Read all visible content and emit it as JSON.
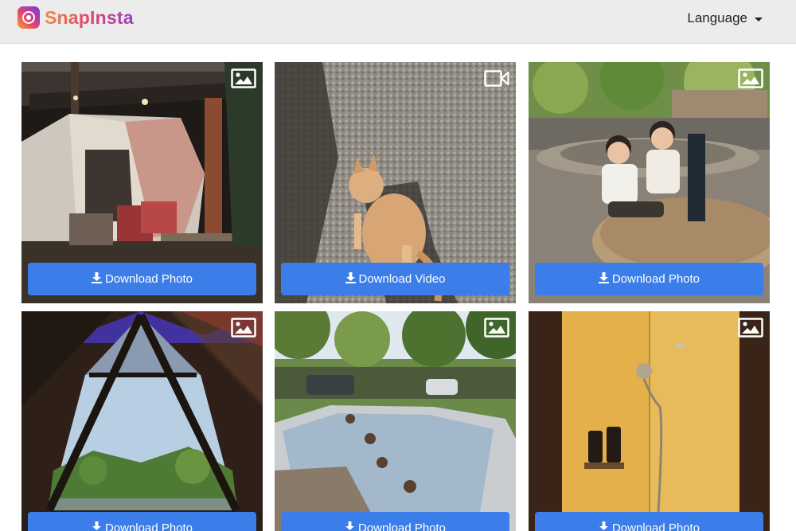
{
  "header": {
    "brand_name": "SnapInsta",
    "language_label": "Language"
  },
  "accent_color": "#3b7de9",
  "cards": [
    {
      "media_type": "image-icon",
      "button_label": "Download Photo"
    },
    {
      "media_type": "video-icon",
      "button_label": "Download Video"
    },
    {
      "media_type": "image-icon",
      "button_label": "Download Photo"
    },
    {
      "media_type": "image-icon",
      "button_label": "Download Photo"
    },
    {
      "media_type": "image-icon",
      "button_label": "Download Photo"
    },
    {
      "media_type": "image-icon",
      "button_label": "Download Photo"
    }
  ]
}
